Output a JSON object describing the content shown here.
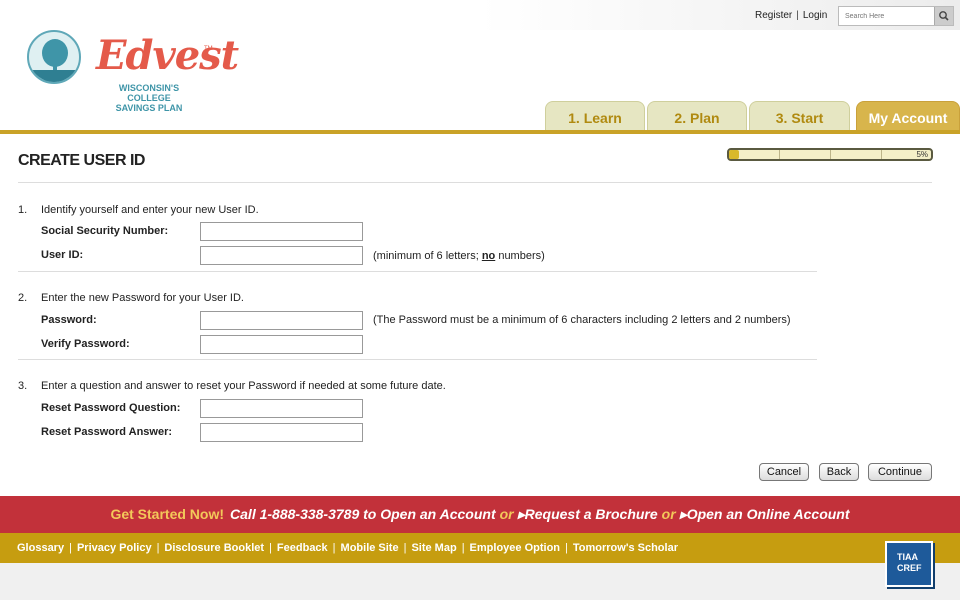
{
  "top": {
    "register": "Register",
    "login": "Login",
    "search_placeholder": "Search Here"
  },
  "logo": {
    "name": "Edvest",
    "tm": "TM",
    "subtitle_line1": "WISCONSIN'S COLLEGE",
    "subtitle_line2": "SAVINGS PLAN"
  },
  "tabs": [
    {
      "label": "1. Learn"
    },
    {
      "label": "2. Plan"
    },
    {
      "label": "3. Start"
    },
    {
      "label": "My Account"
    }
  ],
  "page": {
    "title": "CREATE USER ID",
    "progress_percent": 5,
    "progress_label": "5%"
  },
  "form": {
    "step1": {
      "number": "1.",
      "text": "Identify yourself and enter your new User ID.",
      "ssn_label": "Social Security Number:",
      "userid_label": "User ID:",
      "userid_note_pre": "(minimum of 6 letters; ",
      "userid_note_emph": "no",
      "userid_note_post": " numbers)"
    },
    "step2": {
      "number": "2.",
      "text": "Enter the new Password for your User ID.",
      "password_label": "Password:",
      "password_note": "(The Password must be a minimum of 6 characters including 2 letters and 2 numbers)",
      "verify_label": "Verify Password:"
    },
    "step3": {
      "number": "3.",
      "text": "Enter a question and answer to reset your Password if needed at some future date.",
      "question_label": "Reset Password Question:",
      "answer_label": "Reset Password Answer:"
    }
  },
  "actions": {
    "cancel": "Cancel",
    "back": "Back",
    "continue": "Continue"
  },
  "banner": {
    "get_started": "Get Started Now!",
    "call": "Call 1-888-338-3789 to Open an Account",
    "or": "or",
    "brochure": "▸Request a Brochure",
    "online": "▸Open an Online Account"
  },
  "footer": {
    "links": [
      "Glossary",
      "Privacy Policy",
      "Disclosure Booklet",
      "Feedback",
      "Mobile Site",
      "Site Map",
      "Employee Option",
      "Tomorrow's Scholar"
    ],
    "sep": "|",
    "badge_line1": "TIAA",
    "badge_line2": "CREF"
  },
  "colors": {
    "accent_gold": "#c9a227",
    "brand_red": "#c2313a",
    "logo_red": "#e45a4a",
    "logo_teal": "#3f95a8"
  }
}
